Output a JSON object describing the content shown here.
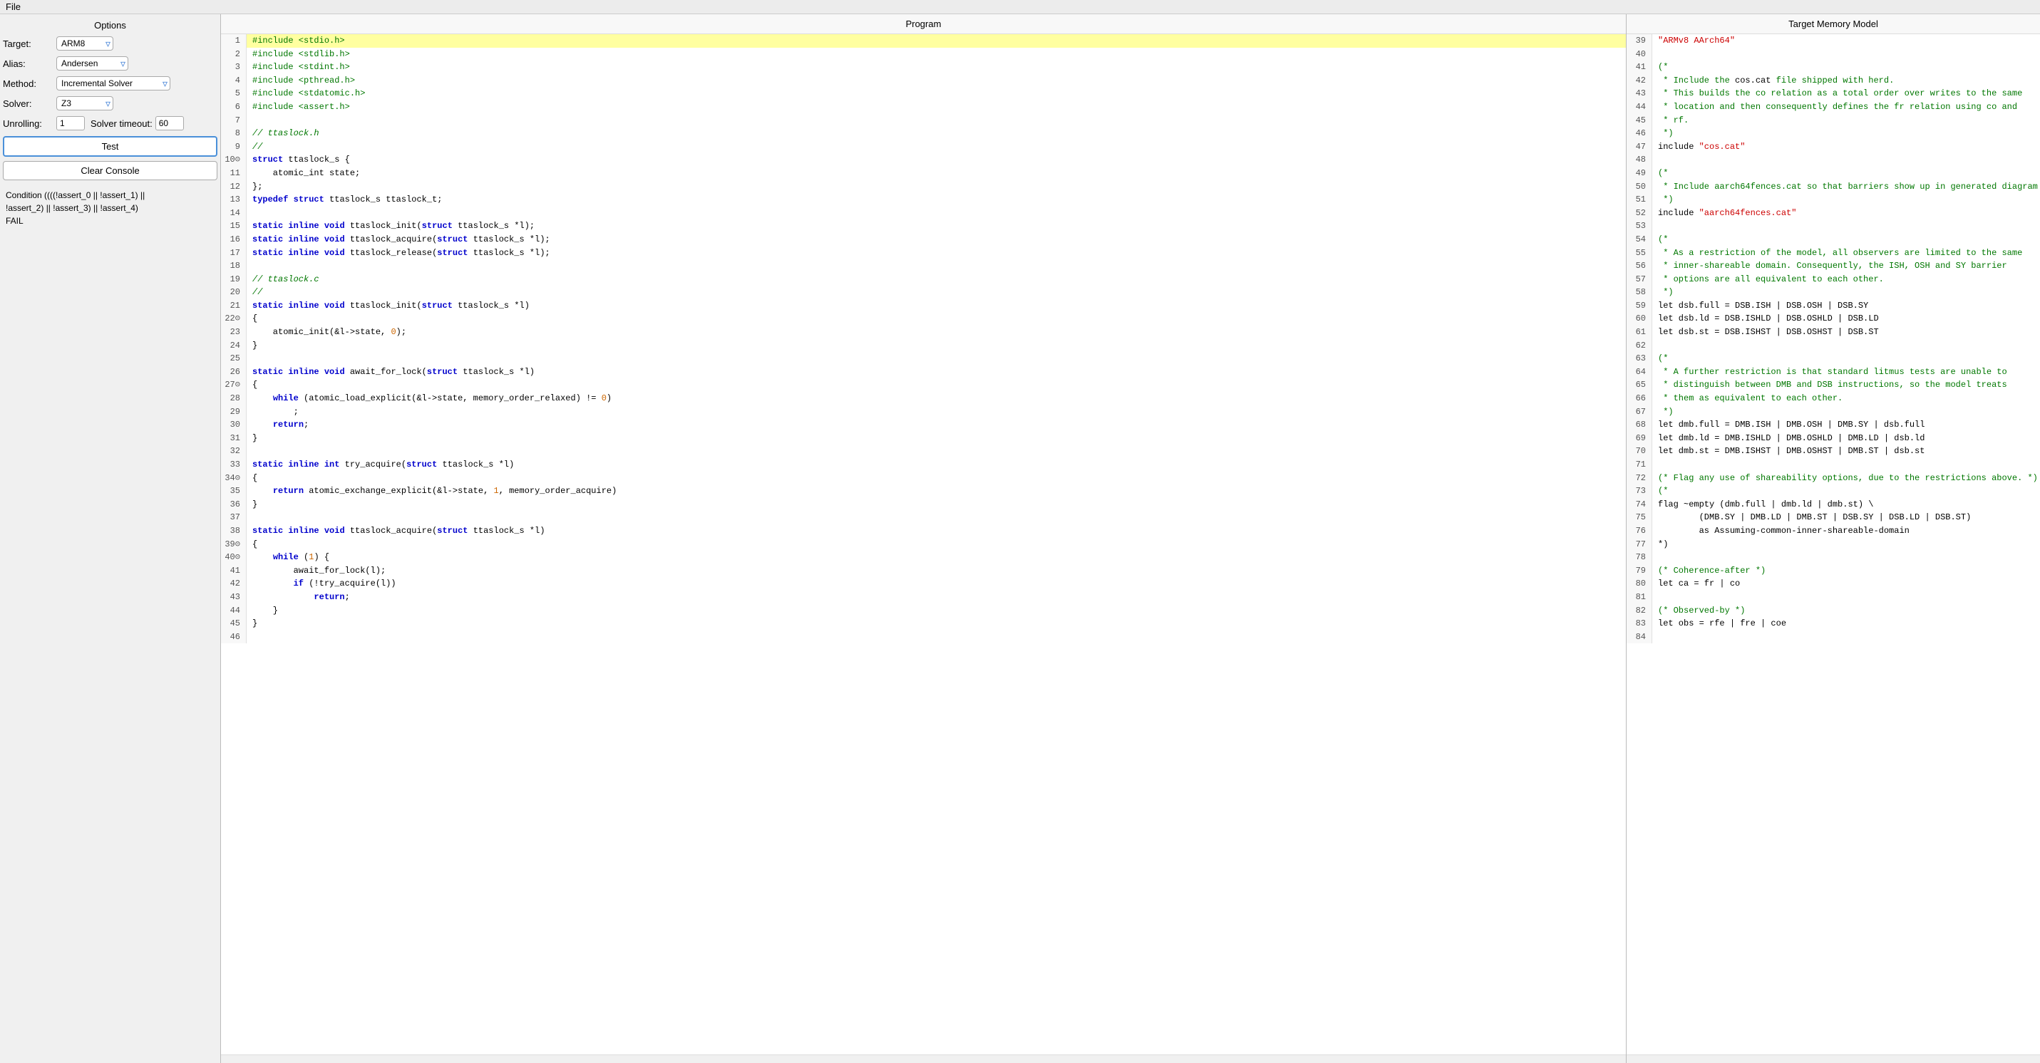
{
  "menubar": {
    "file_label": "File"
  },
  "left_panel": {
    "options_header": "Options",
    "target_label": "Target:",
    "target_value": "ARM8",
    "alias_label": "Alias:",
    "alias_value": "Andersen",
    "method_label": "Method:",
    "method_value": "Incremental Solver",
    "solver_label": "Solver:",
    "solver_value": "Z3",
    "unrolling_label": "Unrolling:",
    "unrolling_value": "1",
    "solver_timeout_label": "Solver timeout:",
    "solver_timeout_value": "60",
    "test_button_label": "Test",
    "clear_console_label": "Clear Console",
    "console_line1": "Condition ((((!assert_0 || !assert_1) ||",
    "console_line2": "!assert_2) || !assert_3) || !assert_4)",
    "console_line3": "FAIL"
  },
  "center_panel": {
    "header": "Program",
    "lines": [
      {
        "num": "1",
        "tokens": [
          {
            "t": "pp",
            "v": "#include <stdio.h>"
          }
        ]
      },
      {
        "num": "2",
        "tokens": [
          {
            "t": "pp",
            "v": "#include <stdlib.h>"
          }
        ]
      },
      {
        "num": "3",
        "tokens": [
          {
            "t": "pp",
            "v": "#include <stdint.h>"
          }
        ]
      },
      {
        "num": "4",
        "tokens": [
          {
            "t": "pp",
            "v": "#include <pthread.h>"
          }
        ]
      },
      {
        "num": "5",
        "tokens": [
          {
            "t": "pp",
            "v": "#include <stdatomic.h>"
          }
        ]
      },
      {
        "num": "6",
        "tokens": [
          {
            "t": "pp",
            "v": "#include <assert.h>"
          }
        ]
      },
      {
        "num": "7",
        "tokens": []
      },
      {
        "num": "8",
        "tokens": [
          {
            "t": "cmt",
            "v": "// ttaslock.h"
          }
        ]
      },
      {
        "num": "9",
        "tokens": [
          {
            "t": "cmt",
            "v": "//"
          }
        ]
      },
      {
        "num": "10",
        "fold": true,
        "tokens": [
          {
            "t": "kw",
            "v": "struct"
          },
          {
            "t": "plain",
            "v": " ttaslock_s {"
          }
        ]
      },
      {
        "num": "11",
        "tokens": [
          {
            "t": "plain",
            "v": "    atomic_int state;"
          }
        ]
      },
      {
        "num": "12",
        "tokens": [
          {
            "t": "plain",
            "v": "};"
          }
        ]
      },
      {
        "num": "13",
        "tokens": [
          {
            "t": "kw",
            "v": "typedef"
          },
          {
            "t": "plain",
            "v": " "
          },
          {
            "t": "kw",
            "v": "struct"
          },
          {
            "t": "plain",
            "v": " ttaslock_s ttaslock_t;"
          }
        ]
      },
      {
        "num": "14",
        "tokens": []
      },
      {
        "num": "15",
        "tokens": [
          {
            "t": "kw",
            "v": "static"
          },
          {
            "t": "plain",
            "v": " "
          },
          {
            "t": "kw",
            "v": "inline"
          },
          {
            "t": "plain",
            "v": " "
          },
          {
            "t": "kw",
            "v": "void"
          },
          {
            "t": "plain",
            "v": " ttaslock_init("
          },
          {
            "t": "kw",
            "v": "struct"
          },
          {
            "t": "plain",
            "v": " ttaslock_s *l);"
          }
        ]
      },
      {
        "num": "16",
        "tokens": [
          {
            "t": "kw",
            "v": "static"
          },
          {
            "t": "plain",
            "v": " "
          },
          {
            "t": "kw",
            "v": "inline"
          },
          {
            "t": "plain",
            "v": " "
          },
          {
            "t": "kw",
            "v": "void"
          },
          {
            "t": "plain",
            "v": " ttaslock_acquire("
          },
          {
            "t": "kw",
            "v": "struct"
          },
          {
            "t": "plain",
            "v": " ttaslock_s *l);"
          }
        ]
      },
      {
        "num": "17",
        "tokens": [
          {
            "t": "kw",
            "v": "static"
          },
          {
            "t": "plain",
            "v": " "
          },
          {
            "t": "kw",
            "v": "inline"
          },
          {
            "t": "plain",
            "v": " "
          },
          {
            "t": "kw",
            "v": "void"
          },
          {
            "t": "plain",
            "v": " ttaslock_release("
          },
          {
            "t": "kw",
            "v": "struct"
          },
          {
            "t": "plain",
            "v": " ttaslock_s *l);"
          }
        ]
      },
      {
        "num": "18",
        "tokens": []
      },
      {
        "num": "19",
        "tokens": [
          {
            "t": "cmt",
            "v": "// ttaslock.c"
          }
        ]
      },
      {
        "num": "20",
        "tokens": [
          {
            "t": "cmt",
            "v": "//"
          }
        ]
      },
      {
        "num": "21",
        "tokens": [
          {
            "t": "kw",
            "v": "static"
          },
          {
            "t": "plain",
            "v": " "
          },
          {
            "t": "kw",
            "v": "inline"
          },
          {
            "t": "plain",
            "v": " "
          },
          {
            "t": "kw",
            "v": "void"
          },
          {
            "t": "plain",
            "v": " ttaslock_init("
          },
          {
            "t": "kw",
            "v": "struct"
          },
          {
            "t": "plain",
            "v": " ttaslock_s *l)"
          }
        ]
      },
      {
        "num": "22",
        "fold": true,
        "tokens": [
          {
            "t": "plain",
            "v": "{"
          }
        ]
      },
      {
        "num": "23",
        "tokens": [
          {
            "t": "plain",
            "v": "    atomic_init(&l->state, "
          },
          {
            "t": "num",
            "v": "0"
          },
          {
            "t": "plain",
            "v": ");"
          }
        ]
      },
      {
        "num": "24",
        "tokens": [
          {
            "t": "plain",
            "v": "}"
          }
        ]
      },
      {
        "num": "25",
        "tokens": []
      },
      {
        "num": "26",
        "tokens": [
          {
            "t": "kw",
            "v": "static"
          },
          {
            "t": "plain",
            "v": " "
          },
          {
            "t": "kw",
            "v": "inline"
          },
          {
            "t": "plain",
            "v": " "
          },
          {
            "t": "kw",
            "v": "void"
          },
          {
            "t": "plain",
            "v": " await_for_lock("
          },
          {
            "t": "kw",
            "v": "struct"
          },
          {
            "t": "plain",
            "v": " ttaslock_s *l)"
          }
        ]
      },
      {
        "num": "27",
        "fold": true,
        "tokens": [
          {
            "t": "plain",
            "v": "{"
          }
        ]
      },
      {
        "num": "28",
        "tokens": [
          {
            "t": "plain",
            "v": "    "
          },
          {
            "t": "kw",
            "v": "while"
          },
          {
            "t": "plain",
            "v": " (atomic_load_explicit(&l->state, memory_order_relaxed) != "
          },
          {
            "t": "num",
            "v": "0"
          },
          {
            "t": "plain",
            "v": ")"
          }
        ]
      },
      {
        "num": "29",
        "tokens": [
          {
            "t": "plain",
            "v": "        ;"
          }
        ]
      },
      {
        "num": "30",
        "tokens": [
          {
            "t": "plain",
            "v": "    "
          },
          {
            "t": "kw",
            "v": "return"
          },
          {
            "t": "plain",
            "v": ";"
          }
        ]
      },
      {
        "num": "31",
        "tokens": [
          {
            "t": "plain",
            "v": "}"
          }
        ]
      },
      {
        "num": "32",
        "tokens": []
      },
      {
        "num": "33",
        "tokens": [
          {
            "t": "kw",
            "v": "static"
          },
          {
            "t": "plain",
            "v": " "
          },
          {
            "t": "kw",
            "v": "inline"
          },
          {
            "t": "plain",
            "v": " "
          },
          {
            "t": "kw",
            "v": "int"
          },
          {
            "t": "plain",
            "v": " try_acquire("
          },
          {
            "t": "kw",
            "v": "struct"
          },
          {
            "t": "plain",
            "v": " ttaslock_s *l)"
          }
        ]
      },
      {
        "num": "34",
        "fold": true,
        "tokens": [
          {
            "t": "plain",
            "v": "{"
          }
        ]
      },
      {
        "num": "35",
        "tokens": [
          {
            "t": "plain",
            "v": "    "
          },
          {
            "t": "kw",
            "v": "return"
          },
          {
            "t": "plain",
            "v": " atomic_exchange_explicit(&l->state, "
          },
          {
            "t": "num",
            "v": "1"
          },
          {
            "t": "plain",
            "v": ", memory_order_acquire)"
          }
        ]
      },
      {
        "num": "36",
        "tokens": [
          {
            "t": "plain",
            "v": "}"
          }
        ]
      },
      {
        "num": "37",
        "tokens": []
      },
      {
        "num": "38",
        "tokens": [
          {
            "t": "kw",
            "v": "static"
          },
          {
            "t": "plain",
            "v": " "
          },
          {
            "t": "kw",
            "v": "inline"
          },
          {
            "t": "plain",
            "v": " "
          },
          {
            "t": "kw",
            "v": "void"
          },
          {
            "t": "plain",
            "v": " ttaslock_acquire("
          },
          {
            "t": "kw",
            "v": "struct"
          },
          {
            "t": "plain",
            "v": " ttaslock_s *l)"
          }
        ]
      },
      {
        "num": "39",
        "fold": true,
        "tokens": [
          {
            "t": "plain",
            "v": "{"
          }
        ]
      },
      {
        "num": "40",
        "fold": true,
        "tokens": [
          {
            "t": "plain",
            "v": "    "
          },
          {
            "t": "kw",
            "v": "while"
          },
          {
            "t": "plain",
            "v": " ("
          },
          {
            "t": "num",
            "v": "1"
          },
          {
            "t": "plain",
            "v": ") {"
          }
        ]
      },
      {
        "num": "41",
        "tokens": [
          {
            "t": "plain",
            "v": "        await_for_lock(l);"
          }
        ]
      },
      {
        "num": "42",
        "tokens": [
          {
            "t": "plain",
            "v": "        "
          },
          {
            "t": "kw",
            "v": "if"
          },
          {
            "t": "plain",
            "v": " (!try_acquire(l))"
          }
        ]
      },
      {
        "num": "43",
        "tokens": [
          {
            "t": "plain",
            "v": "            "
          },
          {
            "t": "kw",
            "v": "return"
          },
          {
            "t": "plain",
            "v": ";"
          }
        ]
      },
      {
        "num": "44",
        "tokens": [
          {
            "t": "plain",
            "v": "    }"
          }
        ]
      },
      {
        "num": "45",
        "tokens": [
          {
            "t": "plain",
            "v": "}"
          }
        ]
      },
      {
        "num": "46",
        "tokens": []
      }
    ]
  },
  "right_panel": {
    "header": "Target Memory Model",
    "lines": [
      {
        "num": "39",
        "tokens": [
          {
            "t": "str",
            "v": "\"ARMv8 AArch64\""
          }
        ]
      },
      {
        "num": "40",
        "tokens": []
      },
      {
        "num": "41",
        "tokens": [
          {
            "t": "cmt",
            "v": "(*"
          }
        ]
      },
      {
        "num": "42",
        "tokens": [
          {
            "t": "cmt",
            "v": " * Include the "
          },
          {
            "t": "plain",
            "v": "cos.cat"
          },
          {
            "t": "cmt",
            "v": " file shipped with herd."
          }
        ]
      },
      {
        "num": "43",
        "tokens": [
          {
            "t": "cmt",
            "v": " * This builds the co relation as a total order over writes to the same"
          }
        ]
      },
      {
        "num": "44",
        "tokens": [
          {
            "t": "cmt",
            "v": " * location and then consequently defines the fr relation using co and"
          }
        ]
      },
      {
        "num": "45",
        "tokens": [
          {
            "t": "cmt",
            "v": " * rf."
          }
        ]
      },
      {
        "num": "46",
        "tokens": [
          {
            "t": "cmt",
            "v": " *)"
          }
        ]
      },
      {
        "num": "47",
        "tokens": [
          {
            "t": "plain",
            "v": "include "
          },
          {
            "t": "str",
            "v": "\"cos.cat\""
          }
        ]
      },
      {
        "num": "48",
        "tokens": []
      },
      {
        "num": "49",
        "tokens": [
          {
            "t": "cmt",
            "v": "(*"
          }
        ]
      },
      {
        "num": "50",
        "tokens": [
          {
            "t": "cmt",
            "v": " * Include aarch64fences.cat so that barriers show up in generated diagram"
          }
        ]
      },
      {
        "num": "51",
        "tokens": [
          {
            "t": "cmt",
            "v": " *)"
          }
        ]
      },
      {
        "num": "52",
        "tokens": [
          {
            "t": "plain",
            "v": "include "
          },
          {
            "t": "str",
            "v": "\"aarch64fences.cat\""
          }
        ]
      },
      {
        "num": "53",
        "tokens": []
      },
      {
        "num": "54",
        "tokens": [
          {
            "t": "cmt",
            "v": "(*"
          }
        ]
      },
      {
        "num": "55",
        "tokens": [
          {
            "t": "cmt",
            "v": " * As a restriction of the model, all observers are limited to the same"
          }
        ]
      },
      {
        "num": "56",
        "tokens": [
          {
            "t": "cmt",
            "v": " * inner-shareable domain. Consequently, the ISH, OSH and SY barrier"
          }
        ]
      },
      {
        "num": "57",
        "tokens": [
          {
            "t": "cmt",
            "v": " * options are all equivalent to each other."
          }
        ]
      },
      {
        "num": "58",
        "tokens": [
          {
            "t": "cmt",
            "v": " *)"
          }
        ]
      },
      {
        "num": "59",
        "tokens": [
          {
            "t": "plain",
            "v": "let dsb.full = DSB.ISH | DSB.OSH | DSB.SY"
          }
        ]
      },
      {
        "num": "60",
        "tokens": [
          {
            "t": "plain",
            "v": "let dsb.ld = DSB.ISHLD | DSB.OSHLD | DSB.LD"
          }
        ]
      },
      {
        "num": "61",
        "tokens": [
          {
            "t": "plain",
            "v": "let dsb.st = DSB.ISHST | DSB.OSHST | DSB.ST"
          }
        ]
      },
      {
        "num": "62",
        "tokens": []
      },
      {
        "num": "63",
        "tokens": [
          {
            "t": "cmt",
            "v": "(*"
          }
        ]
      },
      {
        "num": "64",
        "tokens": [
          {
            "t": "cmt",
            "v": " * A further restriction is that standard litmus tests are unable to"
          }
        ]
      },
      {
        "num": "65",
        "tokens": [
          {
            "t": "cmt",
            "v": " * distinguish between DMB and DSB instructions, so the model treats"
          }
        ]
      },
      {
        "num": "66",
        "tokens": [
          {
            "t": "cmt",
            "v": " * them as equivalent to each other."
          }
        ]
      },
      {
        "num": "67",
        "tokens": [
          {
            "t": "cmt",
            "v": " *)"
          }
        ]
      },
      {
        "num": "68",
        "tokens": [
          {
            "t": "plain",
            "v": "let dmb.full = DMB.ISH | DMB.OSH | DMB.SY | dsb.full"
          }
        ]
      },
      {
        "num": "69",
        "tokens": [
          {
            "t": "plain",
            "v": "let dmb.ld = DMB.ISHLD | DMB.OSHLD | DMB.LD | dsb.ld"
          }
        ]
      },
      {
        "num": "70",
        "tokens": [
          {
            "t": "plain",
            "v": "let dmb.st = DMB.ISHST | DMB.OSHST | DMB.ST | dsb.st"
          }
        ]
      },
      {
        "num": "71",
        "tokens": []
      },
      {
        "num": "72",
        "tokens": [
          {
            "t": "cmt",
            "v": "(* Flag any use of shareability options, due to the restrictions above. *)"
          }
        ]
      },
      {
        "num": "73",
        "tokens": [
          {
            "t": "cmt",
            "v": "(*"
          }
        ]
      },
      {
        "num": "74",
        "tokens": [
          {
            "t": "plain",
            "v": "flag ~empty (dmb.full | dmb.ld | dmb.st) \\"
          }
        ]
      },
      {
        "num": "75",
        "tokens": [
          {
            "t": "plain",
            "v": "        (DMB.SY | DMB.LD | DMB.ST | DSB.SY | DSB.LD | DSB.ST)"
          }
        ]
      },
      {
        "num": "76",
        "tokens": [
          {
            "t": "plain",
            "v": "        as Assuming-common-inner-shareable-domain"
          }
        ]
      },
      {
        "num": "77",
        "tokens": [
          {
            "t": "plain",
            "v": "*)"
          }
        ]
      },
      {
        "num": "78",
        "tokens": []
      },
      {
        "num": "79",
        "tokens": [
          {
            "t": "cmt",
            "v": "(* Coherence-after *)"
          }
        ]
      },
      {
        "num": "80",
        "tokens": [
          {
            "t": "plain",
            "v": "let ca = fr | co"
          }
        ]
      },
      {
        "num": "81",
        "tokens": []
      },
      {
        "num": "82",
        "tokens": [
          {
            "t": "cmt",
            "v": "(* Observed-by *)"
          }
        ]
      },
      {
        "num": "83",
        "tokens": [
          {
            "t": "plain",
            "v": "let obs = rfe | fre | coe"
          }
        ]
      },
      {
        "num": "84",
        "tokens": []
      }
    ]
  }
}
